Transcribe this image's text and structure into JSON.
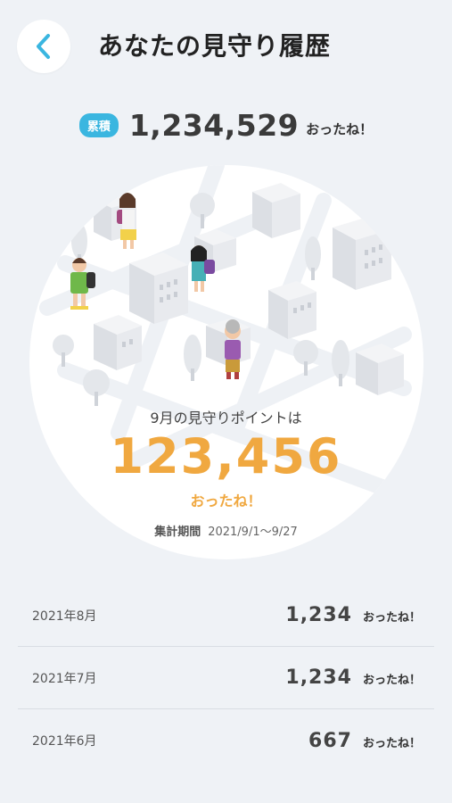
{
  "header": {
    "title": "あなたの見守り履歴",
    "back_icon": "chevron-left-icon"
  },
  "total": {
    "badge": "累積",
    "value": "1,234,529",
    "unit": "おったね！"
  },
  "current": {
    "label": "9月の見守りポイントは",
    "value": "123,456",
    "unit": "おったね！",
    "period_label": "集計期間",
    "period_range": "2021/9/1〜9/27"
  },
  "history": [
    {
      "month": "2021年8月",
      "value": "1,234",
      "unit": "おったね！"
    },
    {
      "month": "2021年7月",
      "value": "1,234",
      "unit": "おったね！"
    },
    {
      "month": "2021年6月",
      "value": "667",
      "unit": "おったね！"
    }
  ],
  "colors": {
    "accent_blue": "#3ab6e0",
    "accent_orange": "#f0a840",
    "background": "#eff2f6"
  }
}
